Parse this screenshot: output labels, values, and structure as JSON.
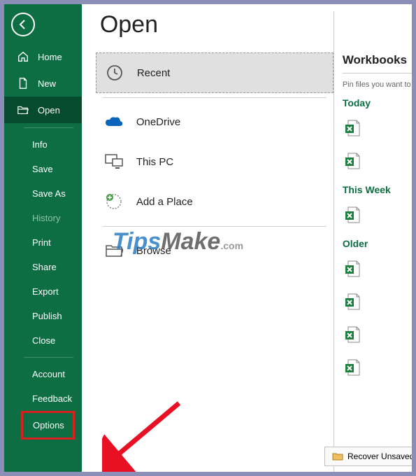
{
  "sidebar": {
    "home": "Home",
    "new": "New",
    "open": "Open",
    "info": "Info",
    "save": "Save",
    "saveAs": "Save As",
    "history": "History",
    "print": "Print",
    "share": "Share",
    "export": "Export",
    "publish": "Publish",
    "close": "Close",
    "account": "Account",
    "feedback": "Feedback",
    "options": "Options"
  },
  "main": {
    "title": "Open",
    "locations": {
      "recent": "Recent",
      "onedrive": "OneDrive",
      "thispc": "This PC",
      "addplace": "Add a Place",
      "browse": "Browse"
    }
  },
  "right": {
    "header": "Workbooks",
    "pinText": "Pin files you want to easily find later.",
    "groups": {
      "today": "Today",
      "thisweek": "This Week",
      "older": "Older"
    },
    "recover": "Recover Unsaved Workbooks"
  },
  "watermark": {
    "t": "Tips",
    "m": "Make",
    "c": ".com"
  }
}
